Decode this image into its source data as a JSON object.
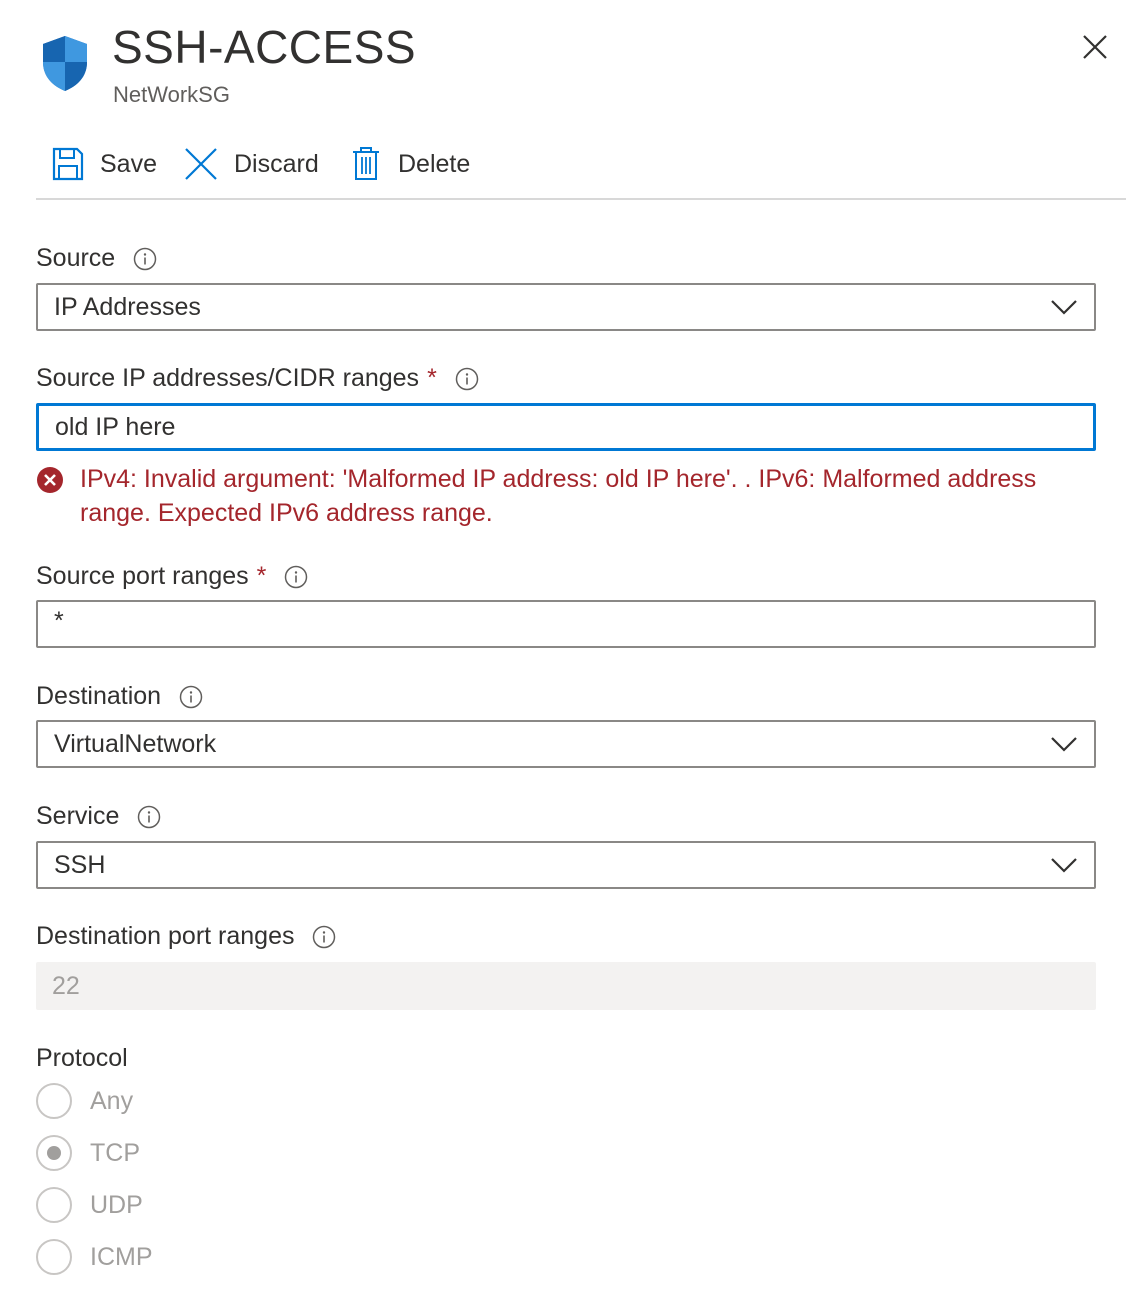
{
  "header": {
    "title": "SSH-ACCESS",
    "subtitle": "NetWorkSG"
  },
  "toolbar": {
    "save_label": "Save",
    "discard_label": "Discard",
    "delete_label": "Delete"
  },
  "form": {
    "source": {
      "label": "Source",
      "value": "IP Addresses"
    },
    "source_ip": {
      "label": "Source IP addresses/CIDR ranges",
      "required_mark": "*",
      "value": "old IP here",
      "error": "IPv4: Invalid argument: 'Malformed IP address: old IP here'. . IPv6: Malformed address range. Expected IPv6 address range."
    },
    "source_port": {
      "label": "Source port ranges",
      "required_mark": "*",
      "value": "*"
    },
    "destination": {
      "label": "Destination",
      "value": "VirtualNetwork"
    },
    "service": {
      "label": "Service",
      "value": "SSH"
    },
    "destination_port": {
      "label": "Destination port ranges",
      "value": "22"
    },
    "protocol": {
      "label": "Protocol",
      "options": [
        "Any",
        "TCP",
        "UDP",
        "ICMP"
      ],
      "selected": "TCP"
    }
  },
  "colors": {
    "accent": "#0078d4",
    "error": "#a4262c",
    "text": "#323130",
    "disabled_text": "#a19f9d"
  }
}
